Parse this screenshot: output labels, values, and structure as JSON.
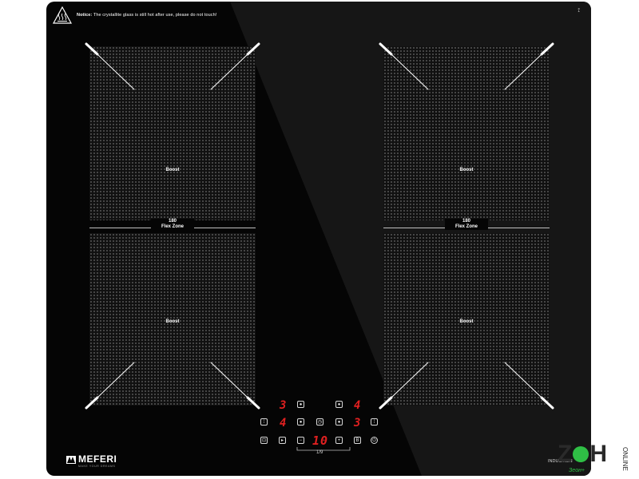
{
  "notice": {
    "label": "Notice:",
    "text": "The crystallite glass is still hot after use, please do not touch!",
    "icon": "hot-surface-warning-icon"
  },
  "corner_mark": "⟟",
  "zones": [
    {
      "id": "front-left",
      "label": "Boost"
    },
    {
      "id": "rear-left",
      "label": "Boost"
    },
    {
      "id": "front-right",
      "label": "Boost"
    },
    {
      "id": "rear-right",
      "label": "Boost"
    }
  ],
  "flex_zones": [
    {
      "number": "180",
      "label": "Flex Zone"
    },
    {
      "number": "180",
      "label": "Flex Zone"
    }
  ],
  "control_panel": {
    "display_top_left": "3",
    "display_top_right": "4",
    "display_mid_left": "4",
    "display_mid_right": "3",
    "display_center": "10",
    "scale_label": "1/9",
    "minus_label": "−",
    "plus_label": "+",
    "boost_label": "B",
    "icons": {
      "lock": "lock-icon",
      "pause": "pause-icon",
      "timer": "timer-icon",
      "power": "power-icon",
      "zone_select": "zone-select-icon",
      "flex_select": "flex-select-icon"
    }
  },
  "brand": {
    "name": "MEFERI",
    "tagline": "MAKE YOUR DREAMS"
  },
  "model_text": "INDUCTION",
  "watermark": {
    "letters_left": "Z",
    "letters_right": "H",
    "sub": "Зеон+",
    "side": "ONLINE",
    "accent": "#2fbf45"
  },
  "colors": {
    "glass": "#050505",
    "display": "#e02020",
    "markings": "#ffffff"
  }
}
